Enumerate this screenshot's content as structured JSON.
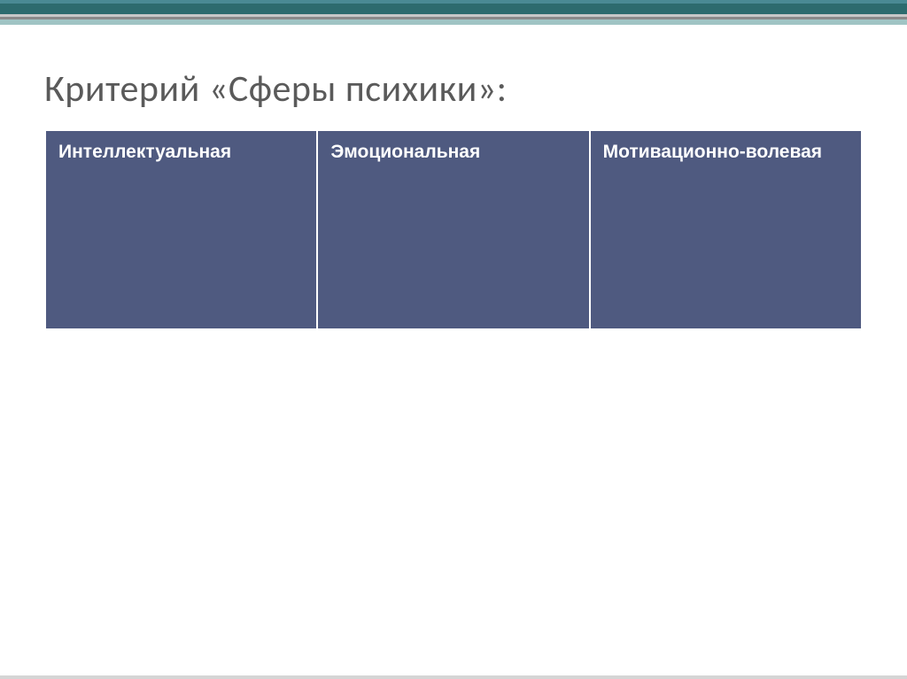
{
  "title": "Критерий «Сферы психики»:",
  "table": {
    "columns": [
      "Интеллектуальная",
      "Эмоциональная",
      "Мотивационно-волевая"
    ]
  },
  "colors": {
    "tableBackground": "#4f5a80",
    "tableText": "#ffffff",
    "titleText": "#5a5a5a"
  }
}
